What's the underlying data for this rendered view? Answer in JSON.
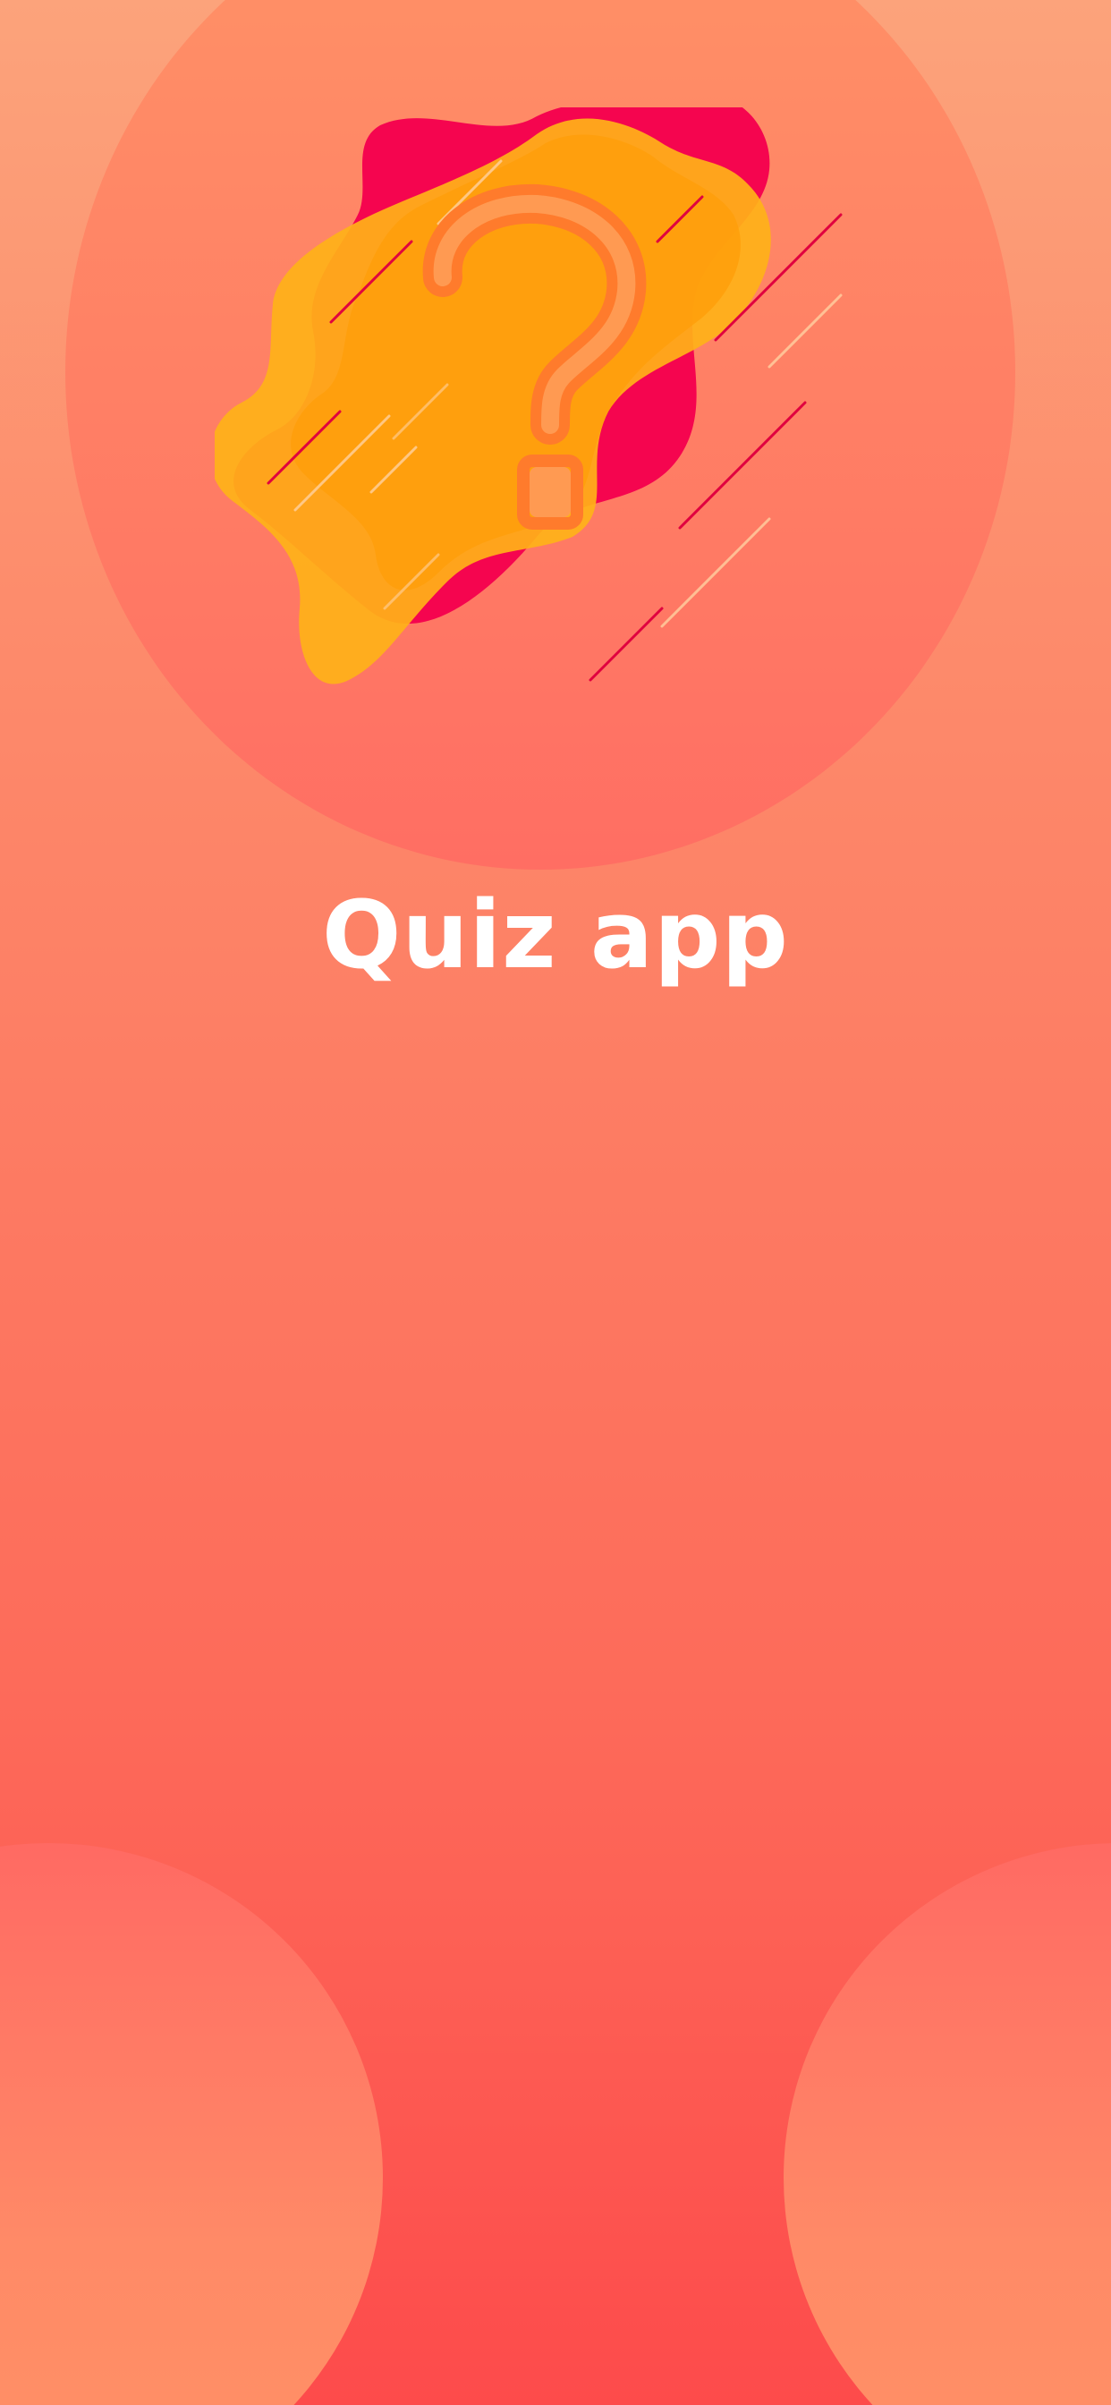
{
  "app": {
    "title": "Quiz app"
  },
  "icons": {
    "logo": "question-mark-icon"
  },
  "colors": {
    "background_top": "#fca37b",
    "background_bottom": "#fd4b4b",
    "blob_yellow": "#ffb218",
    "blob_red": "#f5054f",
    "text": "#ffffff"
  }
}
